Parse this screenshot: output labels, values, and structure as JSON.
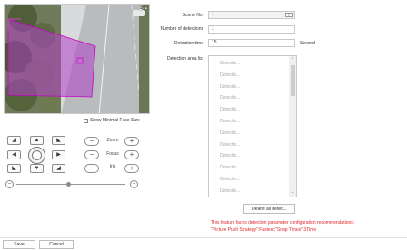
{
  "preview": {
    "osd_text": "E▪▪",
    "show_min_face_label": "Show Minimal Face Size",
    "show_min_face_checked": false
  },
  "ptz": {
    "zoom_label": "Zoom",
    "focus_label": "Focus",
    "iris_label": "Iris",
    "minus": "−",
    "plus": "+",
    "speed_level": 0.48
  },
  "form": {
    "scene_label": "Scene No.",
    "scene_value": "1",
    "detections_label": "Number of detections",
    "detections_value": "1",
    "time_label": "Detection time",
    "time_value": "15",
    "time_unit": "Second",
    "area_list_label": "Detection area list"
  },
  "area_list": {
    "items": [
      "Detectio...",
      "Detectio...",
      "Detectio...",
      "Detectio...",
      "Detectio...",
      "Detectio...",
      "Detectio...",
      "Detectio...",
      "Detectio...",
      "Detectio...",
      "Detectio...",
      "Detectio..."
    ]
  },
  "actions": {
    "delete_all": "Delete all detec...",
    "save": "Save",
    "cancel": "Cancel"
  },
  "notes": {
    "line1": "This feature faces detection parameter configuration recommendations:",
    "line2": "\"Picture Push Strategy\":Fastest;\"Snap Times\":3Time"
  },
  "colors": {
    "roi_fill": "#a24db8",
    "roi_stroke": "#c800c8",
    "warning": "#e0282d"
  }
}
